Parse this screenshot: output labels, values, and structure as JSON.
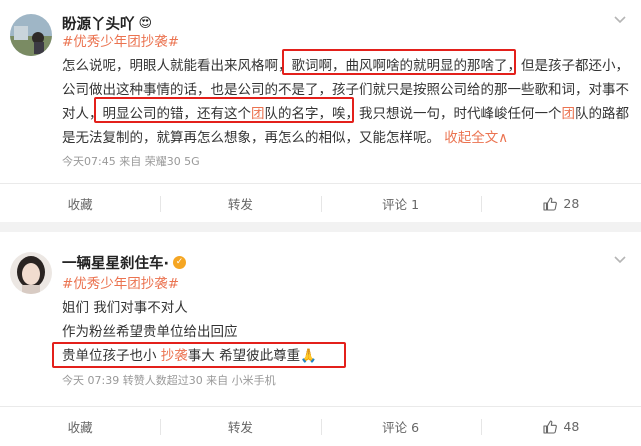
{
  "posts": [
    {
      "username": "盼源丫头吖",
      "badge_emoji": "😍",
      "hashtag": "#优秀少年团抄袭#",
      "lines": [
        {
          "segments": [
            {
              "t": "怎么说呢，明眼人就能看出来风格啊，"
            },
            {
              "t": "歌词啊，曲风啊啥的就明显的那啥了，"
            },
            {
              "t": "但是孩子都还小，"
            }
          ]
        },
        {
          "segments": [
            {
              "t": "公司做出这种事情的话，也是公司的不是了，孩子们就只是按照公司给的那一些歌和词，对事不"
            }
          ]
        },
        {
          "segments": [
            {
              "t": "对人，"
            },
            {
              "t": "明显公司的错，还有这个"
            },
            {
              "t": "团",
              "hl": true
            },
            {
              "t": "队的名字，唉，"
            },
            {
              "t": "我只想说一句，时代峰峻任何一个"
            },
            {
              "t": "团",
              "hl": true
            },
            {
              "t": "队的路都"
            }
          ]
        },
        {
          "segments": [
            {
              "t": "是无法复制的，就算再怎么想象，再怎么的相似，又能怎样呢。 "
            },
            {
              "t": "收起全文",
              "more": true
            },
            {
              "t": "∧",
              "more": true
            }
          ]
        }
      ],
      "meta": "今天07:45  来自 荣耀30 5G",
      "actions": {
        "collect": "收藏",
        "repost": "转发",
        "comment": "评论 1",
        "like": "28"
      }
    },
    {
      "username": "一辆星星刹住车·",
      "badge_emoji": "✓",
      "hashtag": "#优秀少年团抄袭#",
      "lines": [
        {
          "segments": [
            {
              "t": "姐们 我们对事不对人"
            }
          ]
        },
        {
          "segments": [
            {
              "t": "作为粉丝希望贵单位给出回应"
            }
          ]
        },
        {
          "segments": [
            {
              "t": "贵单位孩子也小 "
            },
            {
              "t": "抄袭",
              "hl": true
            },
            {
              "t": "事大 希望彼此尊重"
            },
            {
              "t": "🙏"
            }
          ]
        }
      ],
      "meta": "今天 07:39  转赞人数超过30  来自 小米手机",
      "actions": {
        "collect": "收藏",
        "repost": "转发",
        "comment": "评论 6",
        "like": "48"
      }
    }
  ],
  "colors": {
    "accent": "#eb7350",
    "highlight_box": "#e3201b",
    "meta": "#999999",
    "verified": "#f5a623"
  },
  "icons": [
    "chevron-down-icon",
    "thumb-up-icon",
    "verified-badge-icon",
    "emoji-icon"
  ]
}
